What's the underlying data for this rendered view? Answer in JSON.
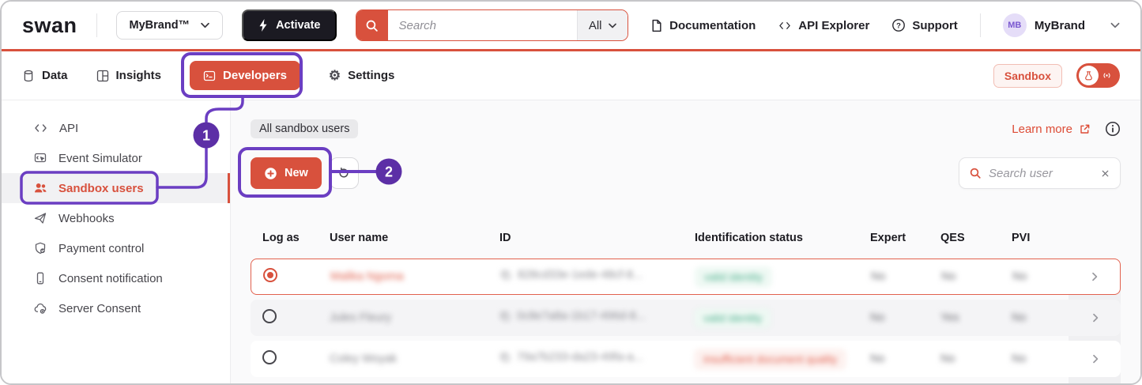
{
  "topbar": {
    "logo": "swan",
    "brand_selector": "MyBrand™",
    "activate_label": "Activate",
    "search": {
      "placeholder": "Search",
      "scope": "All"
    },
    "links": [
      {
        "label": "Documentation"
      },
      {
        "label": "API Explorer"
      },
      {
        "label": "Support"
      }
    ],
    "account": {
      "initials": "MB",
      "name": "MyBrand"
    }
  },
  "nav": {
    "items": [
      {
        "label": "Data"
      },
      {
        "label": "Insights"
      },
      {
        "label": "Developers",
        "active": true
      },
      {
        "label": "Settings"
      }
    ],
    "sandbox_badge": "Sandbox"
  },
  "sidebar": {
    "items": [
      {
        "label": "API"
      },
      {
        "label": "Event Simulator"
      },
      {
        "label": "Sandbox users",
        "selected": true
      },
      {
        "label": "Webhooks"
      },
      {
        "label": "Payment control"
      },
      {
        "label": "Consent notification"
      },
      {
        "label": "Server Consent"
      }
    ]
  },
  "main": {
    "breadcrumb": "All sandbox users",
    "new_label": "New",
    "learn_more": "Learn more",
    "search_placeholder": "Search user",
    "table": {
      "columns": [
        "Log as",
        "User name",
        "ID",
        "Identification status",
        "Expert",
        "QES",
        "PVI"
      ],
      "rows": [
        {
          "selected": true,
          "name": "Malika Ngoma",
          "id": "828cd33e-1ede-48cf-8...",
          "status": "valid identity",
          "status_type": "valid",
          "expert": "No",
          "qes": "No",
          "pvi": "No"
        },
        {
          "selected": false,
          "name": "Jules Fleury",
          "id": "0c8e7a8a-1b17-496d-8...",
          "status": "valid identity",
          "status_type": "valid",
          "expert": "No",
          "qes": "Yes",
          "pvi": "No"
        },
        {
          "selected": false,
          "name": "Coley Woyak",
          "id": "79a7b233-da23-49fa-a...",
          "status": "insufficient document quality",
          "status_type": "invalid",
          "expert": "No",
          "qes": "No",
          "pvi": "No"
        }
      ]
    }
  },
  "annotations": {
    "step1": "1",
    "step2": "2"
  },
  "colors": {
    "accent": "#D8513D",
    "anno": "#6B3EC2",
    "annoFill": "#5C2FA6",
    "valid": "#4CAF8C",
    "invalid": "#E2604E"
  }
}
